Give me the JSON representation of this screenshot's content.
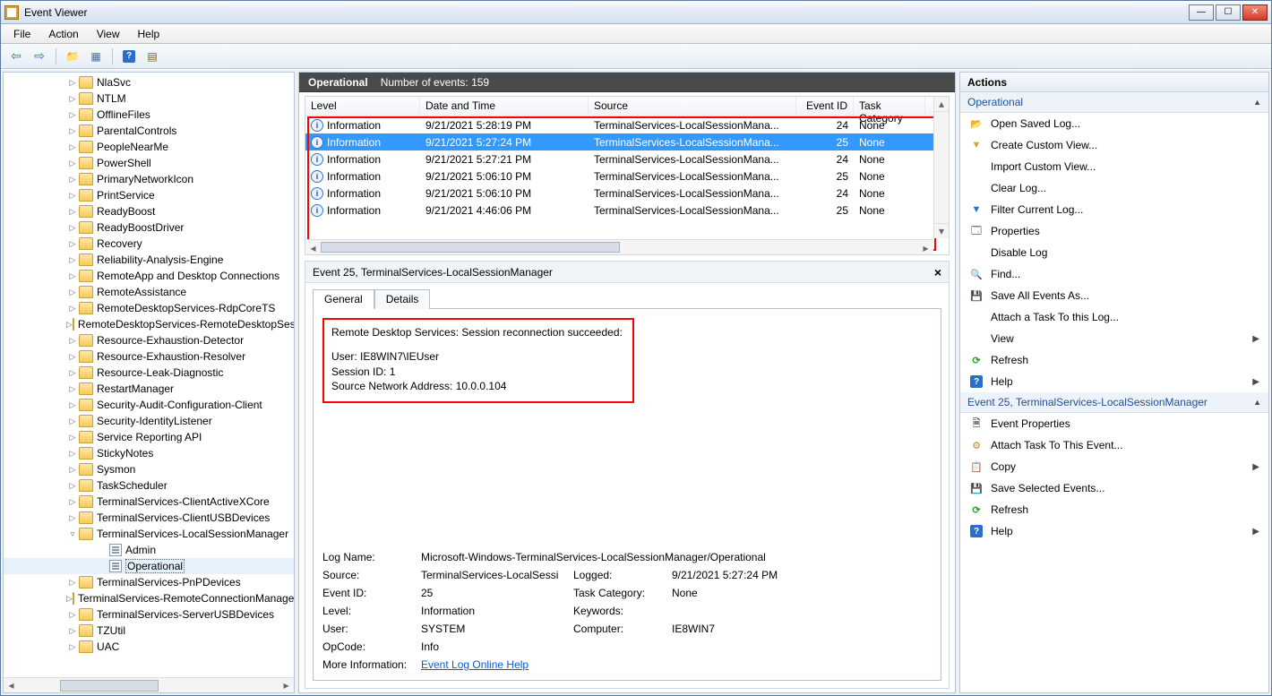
{
  "window": {
    "title": "Event Viewer"
  },
  "menu": {
    "file": "File",
    "action": "Action",
    "view": "View",
    "help": "Help"
  },
  "tree": {
    "indent_base": 70,
    "items": [
      {
        "label": "NlaSvc",
        "caret": "▷"
      },
      {
        "label": "NTLM",
        "caret": "▷"
      },
      {
        "label": "OfflineFiles",
        "caret": "▷"
      },
      {
        "label": "ParentalControls",
        "caret": "▷"
      },
      {
        "label": "PeopleNearMe",
        "caret": "▷"
      },
      {
        "label": "PowerShell",
        "caret": "▷"
      },
      {
        "label": "PrimaryNetworkIcon",
        "caret": "▷"
      },
      {
        "label": "PrintService",
        "caret": "▷"
      },
      {
        "label": "ReadyBoost",
        "caret": "▷"
      },
      {
        "label": "ReadyBoostDriver",
        "caret": "▷"
      },
      {
        "label": "Recovery",
        "caret": "▷"
      },
      {
        "label": "Reliability-Analysis-Engine",
        "caret": "▷"
      },
      {
        "label": "RemoteApp and Desktop Connections",
        "caret": "▷"
      },
      {
        "label": "RemoteAssistance",
        "caret": "▷"
      },
      {
        "label": "RemoteDesktopServices-RdpCoreTS",
        "caret": "▷"
      },
      {
        "label": "RemoteDesktopServices-RemoteDesktopSessionManager",
        "caret": "▷"
      },
      {
        "label": "Resource-Exhaustion-Detector",
        "caret": "▷"
      },
      {
        "label": "Resource-Exhaustion-Resolver",
        "caret": "▷"
      },
      {
        "label": "Resource-Leak-Diagnostic",
        "caret": "▷"
      },
      {
        "label": "RestartManager",
        "caret": "▷"
      },
      {
        "label": "Security-Audit-Configuration-Client",
        "caret": "▷"
      },
      {
        "label": "Security-IdentityListener",
        "caret": "▷"
      },
      {
        "label": "Service Reporting API",
        "caret": "▷"
      },
      {
        "label": "StickyNotes",
        "caret": "▷"
      },
      {
        "label": "Sysmon",
        "caret": "▷"
      },
      {
        "label": "TaskScheduler",
        "caret": "▷"
      },
      {
        "label": "TerminalServices-ClientActiveXCore",
        "caret": "▷"
      },
      {
        "label": "TerminalServices-ClientUSBDevices",
        "caret": "▷"
      },
      {
        "label": "TerminalServices-LocalSessionManager",
        "caret": "▿",
        "expanded": true,
        "children": [
          {
            "label": "Admin",
            "leaf": true
          },
          {
            "label": "Operational",
            "leaf": true,
            "selected": true
          }
        ]
      },
      {
        "label": "TerminalServices-PnPDevices",
        "caret": "▷"
      },
      {
        "label": "TerminalServices-RemoteConnectionManager",
        "caret": "▷"
      },
      {
        "label": "TerminalServices-ServerUSBDevices",
        "caret": "▷"
      },
      {
        "label": "TZUtil",
        "caret": "▷"
      },
      {
        "label": "UAC",
        "caret": "▷"
      }
    ]
  },
  "center": {
    "header_name": "Operational",
    "header_count": "Number of events: 159",
    "columns": {
      "level": "Level",
      "dt": "Date and Time",
      "src": "Source",
      "eid": "Event ID",
      "cat": "Task Category"
    },
    "rows": [
      {
        "level": "Information",
        "dt": "9/21/2021 5:28:19 PM",
        "src": "TerminalServices-LocalSessionMana...",
        "eid": "24",
        "cat": "None"
      },
      {
        "level": "Information",
        "dt": "9/21/2021 5:27:24 PM",
        "src": "TerminalServices-LocalSessionMana...",
        "eid": "25",
        "cat": "None",
        "selected": true
      },
      {
        "level": "Information",
        "dt": "9/21/2021 5:27:21 PM",
        "src": "TerminalServices-LocalSessionMana...",
        "eid": "24",
        "cat": "None"
      },
      {
        "level": "Information",
        "dt": "9/21/2021 5:06:10 PM",
        "src": "TerminalServices-LocalSessionMana...",
        "eid": "25",
        "cat": "None"
      },
      {
        "level": "Information",
        "dt": "9/21/2021 5:06:10 PM",
        "src": "TerminalServices-LocalSessionMana...",
        "eid": "24",
        "cat": "None"
      },
      {
        "level": "Information",
        "dt": "9/21/2021 4:46:06 PM",
        "src": "TerminalServices-LocalSessionMana...",
        "eid": "25",
        "cat": "None"
      }
    ],
    "detail": {
      "title": "Event 25, TerminalServices-LocalSessionManager",
      "tabs": {
        "general": "General",
        "details": "Details"
      },
      "message_l1": "Remote Desktop Services: Session reconnection succeeded:",
      "message_l2": "User: IE8WIN7\\IEUser",
      "message_l3": "Session ID: 1",
      "message_l4": "Source Network Address: 10.0.0.104",
      "props": {
        "log_name_lab": "Log Name:",
        "log_name": "Microsoft-Windows-TerminalServices-LocalSessionManager/Operational",
        "source_lab": "Source:",
        "source": "TerminalServices-LocalSessionManager",
        "logged_lab": "Logged:",
        "logged": "9/21/2021 5:27:24 PM",
        "eid_lab": "Event ID:",
        "eid": "25",
        "cat_lab": "Task Category:",
        "cat": "None",
        "level_lab": "Level:",
        "level": "Information",
        "kw_lab": "Keywords:",
        "kw": "",
        "user_lab": "User:",
        "user": "SYSTEM",
        "comp_lab": "Computer:",
        "comp": "IE8WIN7",
        "op_lab": "OpCode:",
        "op": "Info",
        "more_lab": "More Information:",
        "more_link": "Event Log Online Help"
      }
    }
  },
  "actions": {
    "header": "Actions",
    "section1": "Operational",
    "section2": "Event 25, TerminalServices-LocalSessionManager",
    "items1": [
      {
        "icon": "ic-open",
        "label": "Open Saved Log..."
      },
      {
        "icon": "ic-filter",
        "label": "Create Custom View..."
      },
      {
        "icon": "blank",
        "label": "Import Custom View..."
      },
      {
        "icon": "blank",
        "label": "Clear Log..."
      },
      {
        "icon": "ic-filterblue",
        "label": "Filter Current Log..."
      },
      {
        "icon": "ic-props",
        "label": "Properties"
      },
      {
        "icon": "blank",
        "label": "Disable Log"
      },
      {
        "icon": "ic-find",
        "label": "Find..."
      },
      {
        "icon": "ic-save",
        "label": "Save All Events As..."
      },
      {
        "icon": "blank",
        "label": "Attach a Task To this Log..."
      },
      {
        "icon": "blank",
        "label": "View",
        "chev": true
      },
      {
        "icon": "ic-refresh",
        "label": "Refresh"
      },
      {
        "icon": "ic-help",
        "label": "Help",
        "chev": true
      }
    ],
    "items2": [
      {
        "icon": "ic-ev",
        "label": "Event Properties"
      },
      {
        "icon": "ic-attach",
        "label": "Attach Task To This Event..."
      },
      {
        "icon": "ic-copy",
        "label": "Copy",
        "chev": true
      },
      {
        "icon": "ic-save",
        "label": "Save Selected Events..."
      },
      {
        "icon": "ic-refresh",
        "label": "Refresh"
      },
      {
        "icon": "ic-help",
        "label": "Help",
        "chev": true
      }
    ]
  }
}
